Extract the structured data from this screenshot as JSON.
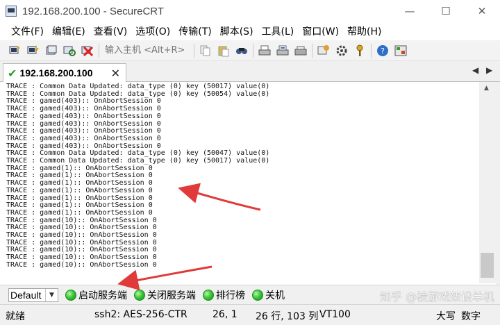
{
  "window": {
    "title": "192.168.200.100 - SecureCRT",
    "minimize": "—",
    "maximize": "☐",
    "close": "✕"
  },
  "menu": [
    "文件(F)",
    "编辑(E)",
    "查看(V)",
    "选项(O)",
    "传输(T)",
    "脚本(S)",
    "工具(L)",
    "窗口(W)",
    "帮助(H)"
  ],
  "toolbar": {
    "host_placeholder": "输入主机 <Alt+R>",
    "icons_left": [
      "connect-icon",
      "quick-connect-icon",
      "connect-tab-icon",
      "reconnect-icon",
      "disconnect-icon"
    ],
    "icons_right": [
      "copy-icon",
      "paste-icon",
      "find-icon",
      "print-icon",
      "print-selection-icon",
      "printer-setup-icon",
      "session-options-icon",
      "global-options-icon",
      "key-icon",
      "help-icon",
      "sftp-icon"
    ]
  },
  "tab": {
    "label": "192.168.200.100",
    "close": "✕",
    "nav_left": "◀",
    "nav_right": "▶"
  },
  "terminal": {
    "lines": [
      "TRACE : Common Data Updated: data_type (0) key (50017) value(0)",
      "TRACE : Common Data Updated: data_type (0) key (50054) value(0)",
      "TRACE : gamed(403):: OnAbortSession 0",
      "TRACE : gamed(403):: OnAbortSession 0",
      "TRACE : gamed(403):: OnAbortSession 0",
      "TRACE : gamed(403):: OnAbortSession 0",
      "TRACE : gamed(403):: OnAbortSession 0",
      "TRACE : gamed(403):: OnAbortSession 0",
      "TRACE : gamed(403):: OnAbortSession 0",
      "TRACE : Common Data Updated: data_type (0) key (50047) value(0)",
      "TRACE : Common Data Updated: data_type (0) key (50017) value(0)",
      "TRACE : gamed(1):: OnAbortSession 0",
      "TRACE : gamed(1):: OnAbortSession 0",
      "TRACE : gamed(1):: OnAbortSession 0",
      "TRACE : gamed(1):: OnAbortSession 0",
      "TRACE : gamed(1):: OnAbortSession 0",
      "TRACE : gamed(1):: OnAbortSession 0",
      "TRACE : gamed(1):: OnAbortSession 0",
      "TRACE : gamed(10):: OnAbortSession 0",
      "TRACE : gamed(10):: OnAbortSession 0",
      "TRACE : gamed(10):: OnAbortSession 0",
      "TRACE : gamed(10):: OnAbortSession 0",
      "TRACE : gamed(10):: OnAbortSession 0",
      "TRACE : gamed(10):: OnAbortSession 0",
      "TRACE : gamed(10):: OnAbortSession 0"
    ]
  },
  "button_bar": {
    "session_select": "Default",
    "buttons": [
      "启动服务端",
      "关闭服务端",
      "排行榜",
      "关机"
    ],
    "watermark": "知乎 @棱游戏架设单机"
  },
  "status": {
    "ready": "就绪",
    "cipher": "ssh2: AES-256-CTR",
    "cursor": "26,  1",
    "size": "26 行, 103 列",
    "term": "VT100",
    "caps": "大写",
    "num": "数字"
  },
  "colors": {
    "accent_green": "#2d9a2d",
    "arrow_red": "#e03a3a"
  }
}
